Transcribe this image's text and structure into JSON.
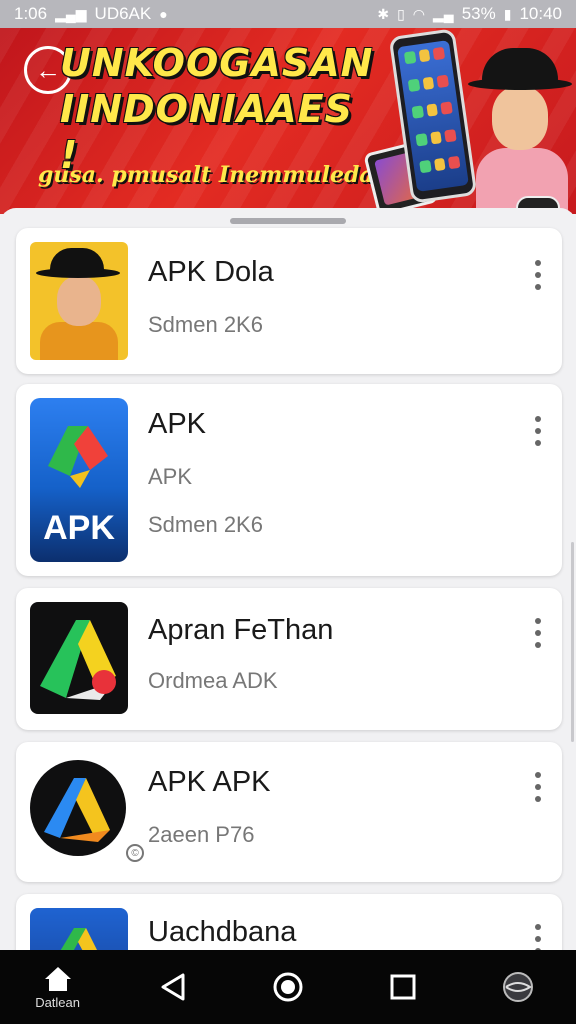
{
  "status_bar": {
    "time_left": "1:06",
    "carrier": "UD6AK",
    "battery": "53%",
    "clock": "10:40"
  },
  "banner": {
    "title_line1": "UNKOOGASAN",
    "title_line2": "IINDONIAAES !",
    "subtitle": "gusa. pmusalt Inemmuledar"
  },
  "apps": [
    {
      "title": "APK Dola",
      "meta": "Sdmen 2K6"
    },
    {
      "title": "APK",
      "subtitle": "APK",
      "meta": "Sdmen 2K6",
      "icon_label": "APK"
    },
    {
      "title": "Apran FeThan",
      "meta": "Ordmea ADK"
    },
    {
      "title": "APK APK",
      "meta": "2aeen P76"
    },
    {
      "title": "Uachdbana"
    }
  ],
  "nav": {
    "home_label": "Datlean"
  },
  "colors": {
    "banner_red": "#d8201f",
    "title_yellow": "#ffe84a",
    "nav_black": "#060606"
  }
}
